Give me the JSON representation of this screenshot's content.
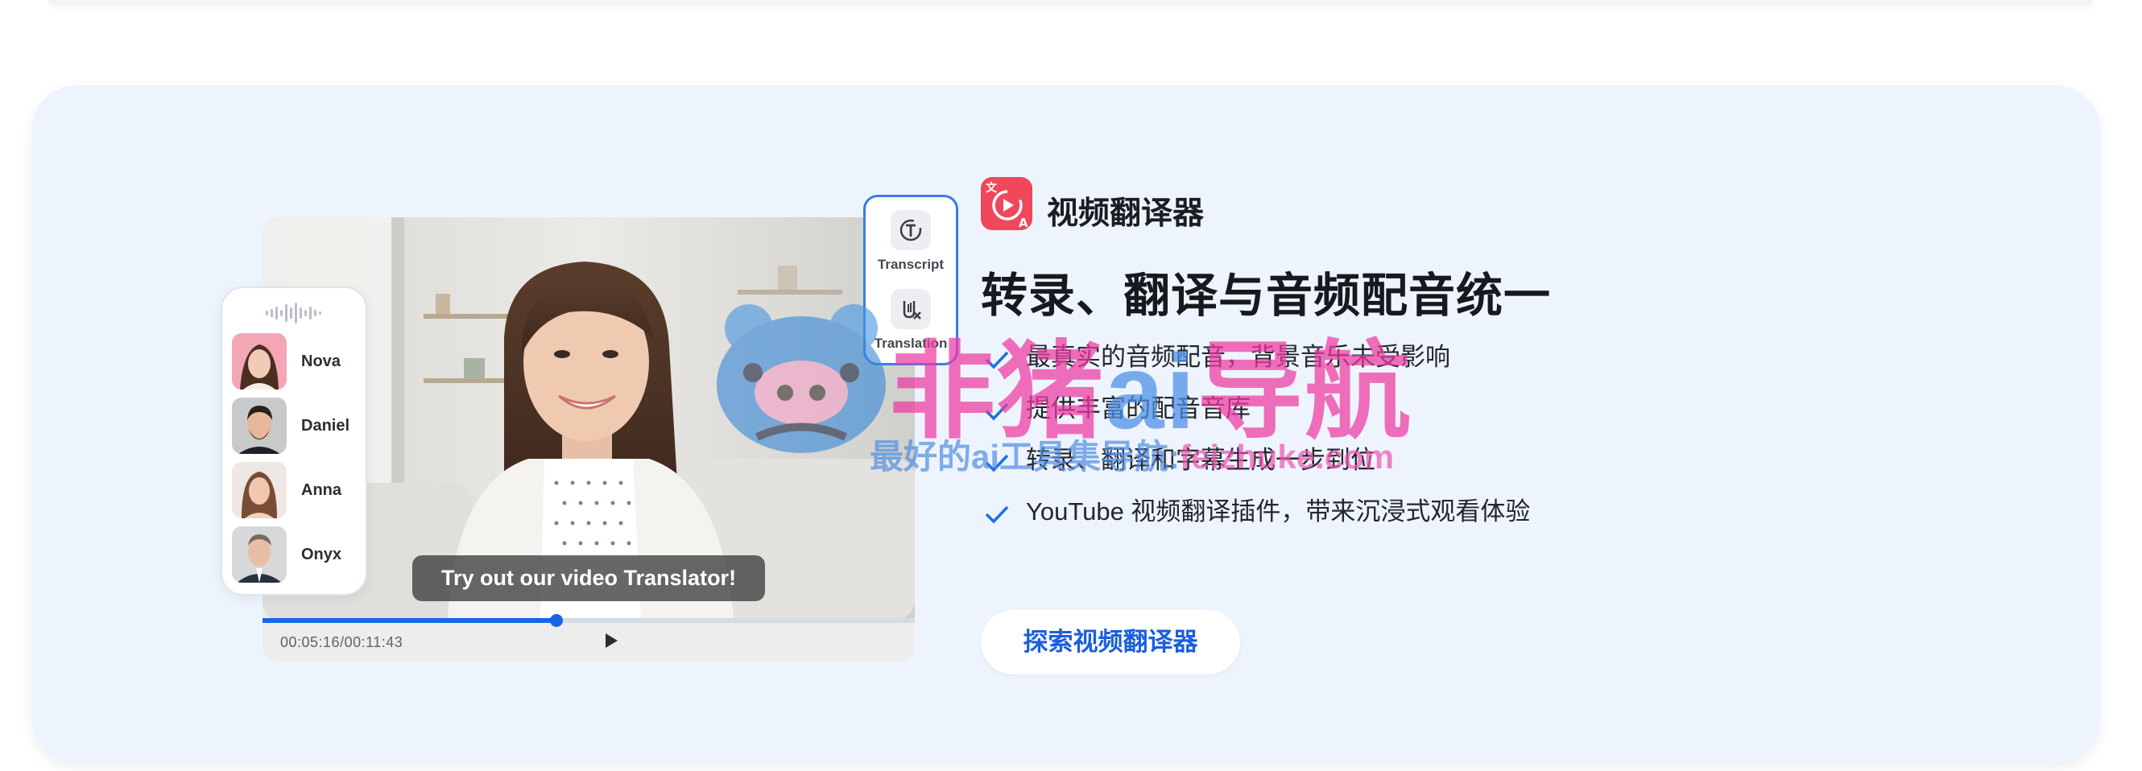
{
  "colors": {
    "card_bg": "#eef4fd",
    "accent_blue": "#1766e6",
    "brand_red": "#f0475b",
    "cta_text": "#1a5fdd",
    "watermark_pink": "#ee3aa3",
    "watermark_blue": "#4a8ee6"
  },
  "video": {
    "caption": "Try out our video Translator!",
    "time": "00:05:16/00:11:43",
    "progress_fraction": 0.45,
    "play_icon": "play-icon"
  },
  "voices": {
    "wave_icon": "waveform-icon",
    "items": [
      {
        "name": "Nova"
      },
      {
        "name": "Daniel"
      },
      {
        "name": "Anna"
      },
      {
        "name": "Onyx"
      }
    ]
  },
  "tools": [
    {
      "label": "Transcript",
      "icon": "transcript-icon"
    },
    {
      "label": "Translation",
      "icon": "translation-icon"
    }
  ],
  "brand": {
    "name": "视频翻译器",
    "logo_icon": "video-translator-logo"
  },
  "headline": "转录、翻译与音频配音统一",
  "features": [
    "最真实的音频配音，背景音乐未受影响",
    "提供丰富的配音音库",
    "转录、翻译和字幕生成一步到位",
    "YouTube 视频翻译插件，带来沉浸式观看体验"
  ],
  "cta": {
    "label": "探索视频翻译器"
  },
  "watermark": {
    "title_a": "非猪",
    "title_ai": "ai",
    "title_b": "导航",
    "subtitle": "最好的ai工具集导航:",
    "url": "feizhuke.com"
  }
}
